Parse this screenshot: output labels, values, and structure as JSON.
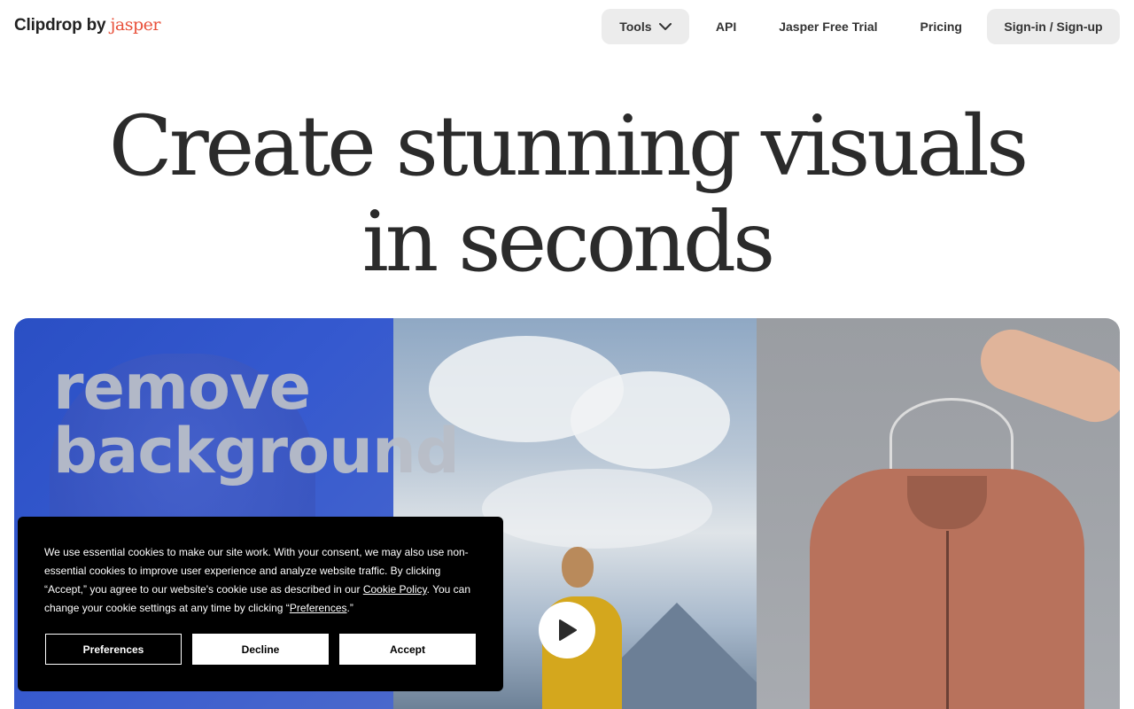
{
  "header": {
    "logo": {
      "name": "Clipdrop",
      "by": "by",
      "brand": "jasper"
    },
    "nav": {
      "tools_label": "Tools",
      "api_label": "API",
      "trial_label": "Jasper Free Trial",
      "pricing_label": "Pricing",
      "sign_label": "Sign-in / Sign-up"
    }
  },
  "hero": {
    "line1": "Create stunning visuals",
    "line2": "in seconds"
  },
  "video": {
    "overlay_line1": "remove",
    "overlay_line2": "background",
    "play_icon": "play-icon"
  },
  "cookie": {
    "text_part1": "We use essential cookies to make our site work. With your consent, we may also use non-essential cookies to improve user experience and analyze website traffic. By clicking “Accept,” you agree to our website's cookie use as described in our ",
    "cookie_policy_link": "Cookie Policy",
    "text_part2": ". You can change your cookie settings at any time by clicking “",
    "preferences_link": "Preferences",
    "text_part3": ".”",
    "preferences_button": "Preferences",
    "decline_button": "Decline",
    "accept_button": "Accept"
  },
  "colors": {
    "brand_accent": "#e8503a",
    "nav_button_bg": "#ececec",
    "cookie_bg": "#000000"
  }
}
